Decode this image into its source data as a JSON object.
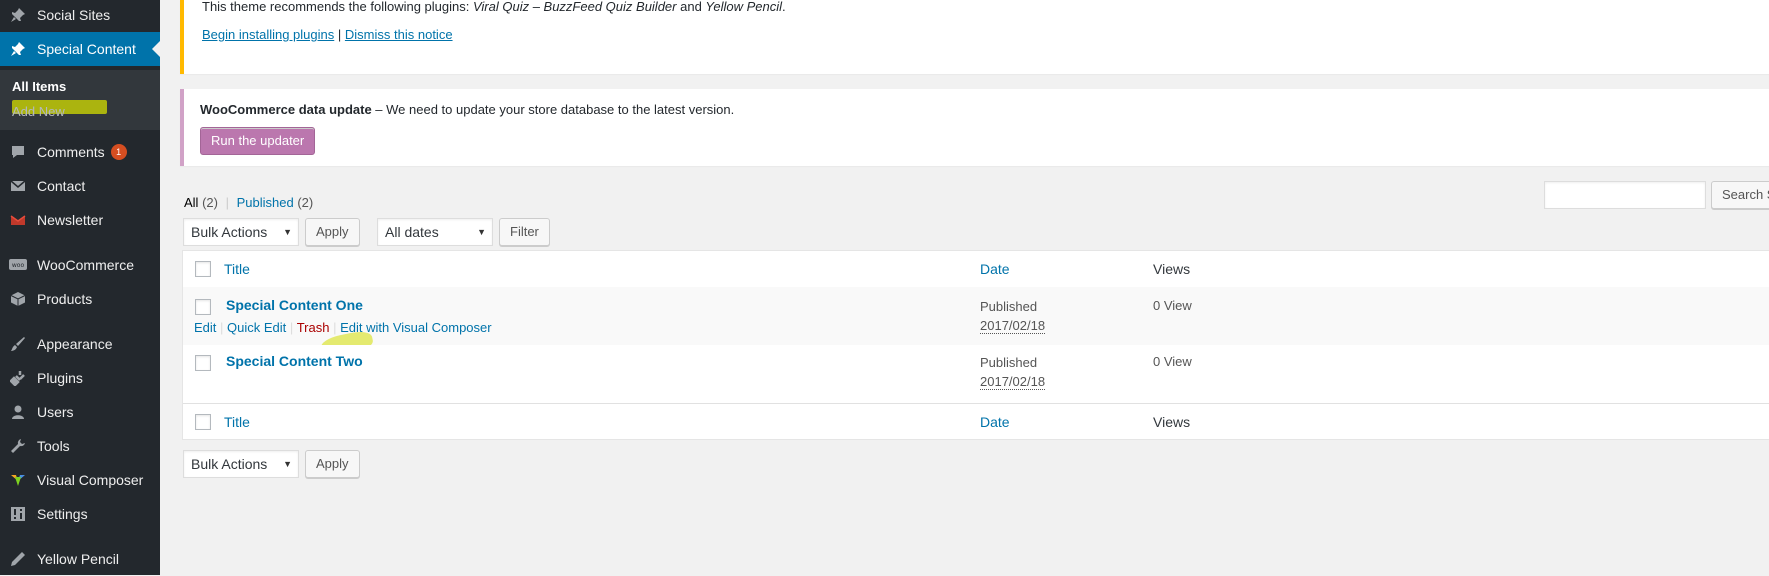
{
  "sidebar": {
    "items": [
      {
        "label": "Social Sites",
        "icon": "pin-icon"
      },
      {
        "label": "Special Content",
        "icon": "pin-icon",
        "current": true
      },
      {
        "label": "Comments",
        "icon": "comment-icon",
        "badge": "1"
      },
      {
        "label": "Contact",
        "icon": "mail-icon"
      },
      {
        "label": "Newsletter",
        "icon": "newsletter-icon"
      },
      {
        "label": "WooCommerce",
        "icon": "woocommerce-icon"
      },
      {
        "label": "Products",
        "icon": "cube-icon"
      },
      {
        "label": "Appearance",
        "icon": "brush-icon"
      },
      {
        "label": "Plugins",
        "icon": "plug-icon"
      },
      {
        "label": "Users",
        "icon": "user-icon"
      },
      {
        "label": "Tools",
        "icon": "wrench-icon"
      },
      {
        "label": "Visual Composer",
        "icon": "visual-composer-icon"
      },
      {
        "label": "Settings",
        "icon": "settings-icon"
      },
      {
        "label": "Yellow Pencil",
        "icon": "pencil-icon"
      }
    ],
    "submenu": {
      "all_items": "All Items",
      "add_new": "Add New"
    }
  },
  "notices": {
    "theme": {
      "text_prefix": "This theme recommends the following plugins: ",
      "plugin_1": "Viral Quiz – BuzzFeed Quiz Builder",
      "and": " and ",
      "plugin_2": "Yellow Pencil",
      "period": ".",
      "begin_link": "Begin installing plugins",
      "separator": "|",
      "dismiss_link": "Dismiss this notice"
    },
    "woo": {
      "title": "WooCommerce data update",
      "message": " – We need to update your store database to the latest version.",
      "button": "Run the updater"
    }
  },
  "filters": {
    "all_label": "All",
    "all_count": "(2)",
    "sep": "|",
    "published_label": "Published",
    "published_count": "(2)",
    "bulk_actions": "Bulk Actions",
    "apply": "Apply",
    "all_dates": "All dates",
    "filter": "Filter",
    "search_button": "Search Special Content",
    "search_value": ""
  },
  "table": {
    "columns": {
      "title": "Title",
      "date": "Date",
      "views": "Views"
    },
    "rows": [
      {
        "title": "Special Content One",
        "status": "Published",
        "date": "2017/02/18",
        "views": "0 View"
      },
      {
        "title": "Special Content Two",
        "status": "Published",
        "date": "2017/02/18",
        "views": "0 View"
      }
    ],
    "row_actions": {
      "edit": "Edit",
      "quick_edit": "Quick Edit",
      "trash": "Trash",
      "edit_vc": "Edit with Visual Composer",
      "sep": "|"
    }
  },
  "colors": {
    "sidebar_bg": "#23282d",
    "accent": "#0073aa",
    "woo_button": "#bb77ae",
    "highlight": "#d4df00"
  }
}
